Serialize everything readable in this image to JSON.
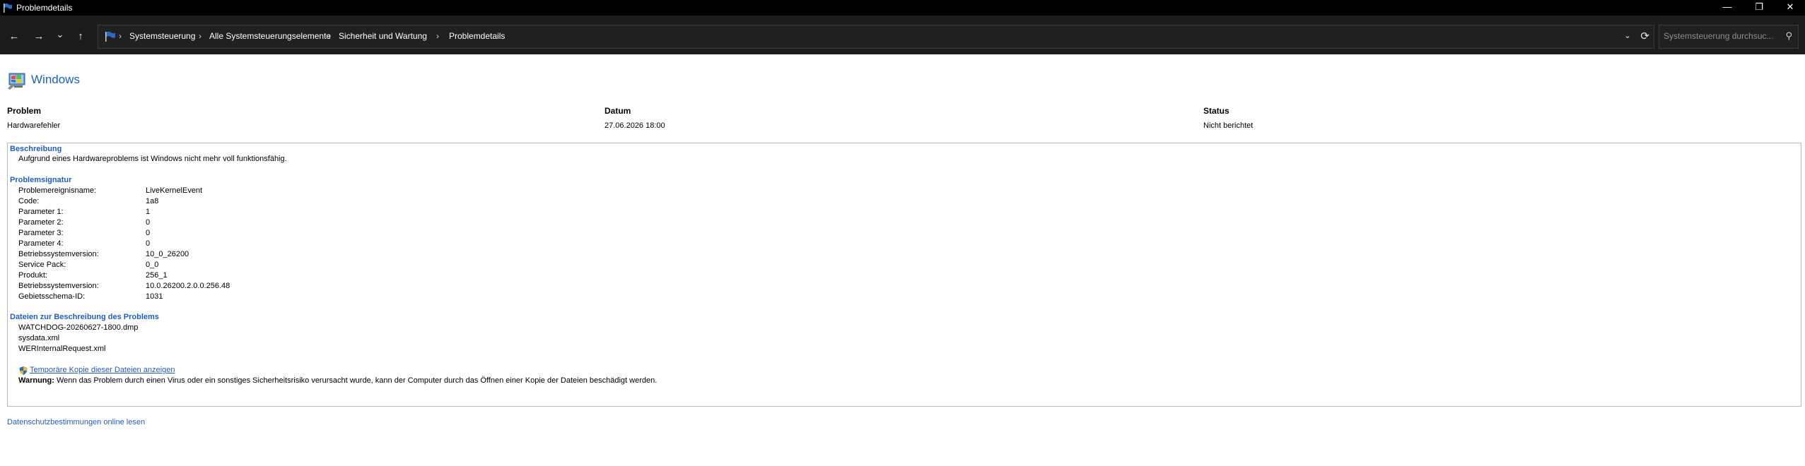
{
  "window": {
    "title": "Problemdetails",
    "controls": {
      "minimize": "—",
      "restore": "❐",
      "close": "✕"
    }
  },
  "nav": {
    "back_icon": "←",
    "forward_icon": "→",
    "recent_icon": "⌄",
    "up_icon": "↑",
    "breadcrumb": [
      "Systemsteuerung",
      "Alle Systemsteuerungselemente",
      "Sicherheit und Wartung",
      "Problemdetails"
    ],
    "separator": "›",
    "dropdown_icon": "⌄",
    "refresh_icon": "⟳",
    "search_placeholder": "Systemsteuerung durchsuc...",
    "search_icon": "⚲"
  },
  "header": {
    "product": "Windows"
  },
  "summary": {
    "columns": [
      {
        "label": "Problem",
        "value": "Hardwarefehler"
      },
      {
        "label": "Datum",
        "value": "27.06.2026 18:00"
      },
      {
        "label": "Status",
        "value": "Nicht berichtet"
      }
    ]
  },
  "details": {
    "description_title": "Beschreibung",
    "description_text": "Aufgrund eines Hardwareproblems ist Windows nicht mehr voll funktionsfähig.",
    "signature_title": "Problemsignatur",
    "signature": [
      {
        "key": "Problemereignisname:",
        "value": "LiveKernelEvent"
      },
      {
        "key": "Code:",
        "value": "1a8"
      },
      {
        "key": "Parameter 1:",
        "value": "1"
      },
      {
        "key": "Parameter 2:",
        "value": "0"
      },
      {
        "key": "Parameter 3:",
        "value": "0"
      },
      {
        "key": "Parameter 4:",
        "value": "0"
      },
      {
        "key": "Betriebssystemversion:",
        "value": "10_0_26200"
      },
      {
        "key": "Service Pack:",
        "value": "0_0"
      },
      {
        "key": "Produkt:",
        "value": "256_1"
      },
      {
        "key": "Betriebssystemversion:",
        "value": "10.0.26200.2.0.0.256.48"
      },
      {
        "key": "Gebietsschema-ID:",
        "value": "1031"
      }
    ],
    "files_title": "Dateien zur Beschreibung des Problems",
    "files": [
      "WATCHDOG-20260627-1800.dmp",
      "sysdata.xml",
      "WERInternalRequest.xml"
    ],
    "temp_copy_link": "Temporäre Kopie dieser Dateien anzeigen",
    "warning_label": "Warnung:",
    "warning_text": " Wenn das Problem durch einen Virus oder ein sonstiges Sicherheitsrisiko verursacht wurde, kann der Computer durch das Öffnen einer Kopie der Dateien beschädigt werden."
  },
  "footer": {
    "privacy_link": "Datenschutzbestimmungen online lesen"
  },
  "colors": {
    "link": "#1f5fb6",
    "titlebar": "#000000",
    "navbar": "#1c1c1c"
  }
}
